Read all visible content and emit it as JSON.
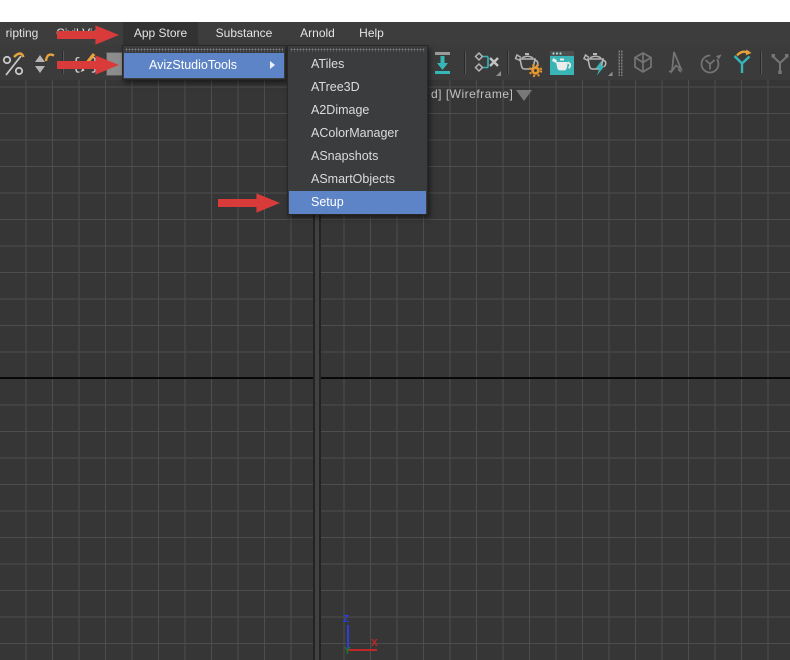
{
  "menu_bar": {
    "items": [
      "ripting",
      "Civil View",
      "App Store",
      "Substance",
      "Arnold",
      "Help"
    ],
    "open_item": "App Store"
  },
  "toolbar": {
    "icons": [
      "percent-snap",
      "spinner-snap",
      "edit-named-selection-sets",
      "import",
      "schematic-view",
      "render-setup",
      "rendered-frame-window",
      "render-production",
      "transform-gizmo",
      "select",
      "rotate",
      "axis-tripod",
      "axis-tripod-alt"
    ]
  },
  "app_store_menu": {
    "items": [
      {
        "label": "AvizStudioTools",
        "highlighted": true,
        "has_submenu": true
      }
    ]
  },
  "aviz_submenu": {
    "items": [
      "ATiles",
      "ATree3D",
      "A2Dimage",
      "AColorManager",
      "ASnapshots",
      "ASmartObjects",
      "Setup"
    ],
    "highlighted_item": "Setup"
  },
  "viewport": {
    "label": "d] [Wireframe]",
    "axis_labels": {
      "x": "X",
      "y": "Y",
      "z": "Z"
    }
  },
  "annotations": {
    "arrow_color": "#d93b3b",
    "arrows": [
      "points-at-app-store",
      "points-at-avizstudiotools",
      "points-at-setup"
    ]
  },
  "colors": {
    "menu_highlight": "#5d84c6",
    "accent_teal": "#35b7b7",
    "accent_orange": "#e8a33d",
    "viewport_bg": "#363636",
    "grid_line": "#4d4d4d",
    "menubar_bg": "#3d3d3d"
  }
}
